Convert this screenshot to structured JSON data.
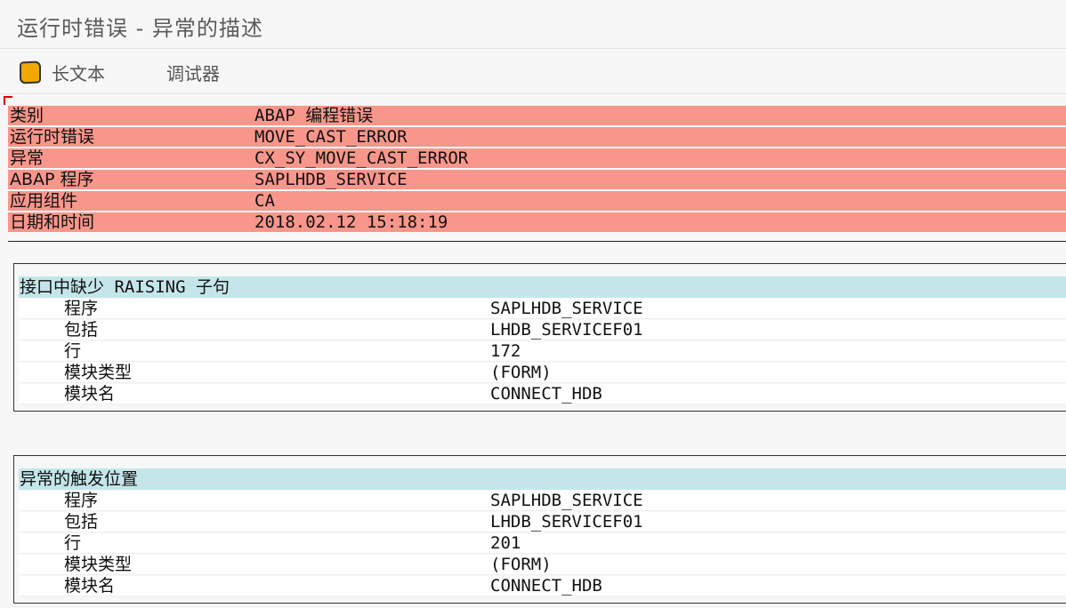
{
  "window": {
    "title": "运行时错误 - 异常的描述"
  },
  "toolbar": {
    "longtext_label": "长文本",
    "longtext_icon": "document-icon",
    "debugger_label": "调试器"
  },
  "summary": [
    {
      "label": "类别",
      "value": "ABAP 编程错误"
    },
    {
      "label": "运行时错误",
      "value": "MOVE_CAST_ERROR"
    },
    {
      "label": "异常",
      "value": "CX_SY_MOVE_CAST_ERROR"
    },
    {
      "label": "ABAP 程序",
      "value": "SAPLHDB_SERVICE"
    },
    {
      "label": "应用组件",
      "value": "CA"
    },
    {
      "label": "日期和时间",
      "value": "2018.02.12 15:18:19"
    }
  ],
  "sections": [
    {
      "title": "接口中缺少 RAISING 子句",
      "rows": [
        {
          "label": "程序",
          "value": "SAPLHDB_SERVICE"
        },
        {
          "label": "包括",
          "value": "LHDB_SERVICEF01"
        },
        {
          "label": "行",
          "value": "172"
        },
        {
          "label": "模块类型",
          "value": "(FORM)"
        },
        {
          "label": "模块名",
          "value": "CONNECT_HDB"
        }
      ]
    },
    {
      "title": "异常的触发位置",
      "rows": [
        {
          "label": "程序",
          "value": "SAPLHDB_SERVICE"
        },
        {
          "label": "包括",
          "value": "LHDB_SERVICEF01"
        },
        {
          "label": "行",
          "value": "201"
        },
        {
          "label": "模块类型",
          "value": "(FORM)"
        },
        {
          "label": "模块名",
          "value": "CONNECT_HDB"
        }
      ]
    }
  ],
  "colors": {
    "summary_bg": "#f9968b",
    "section_header_bg": "#c4e6ea",
    "icon_fill": "#f2a800"
  }
}
